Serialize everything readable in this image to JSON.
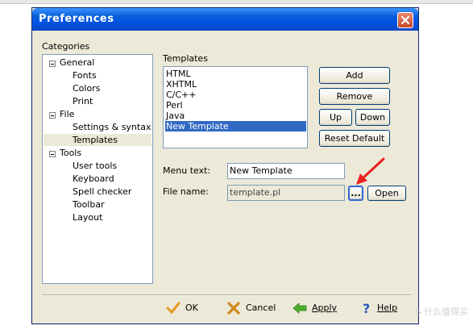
{
  "window": {
    "title": "Preferences"
  },
  "categories": {
    "label": "Categories",
    "tree": [
      {
        "label": "General",
        "expanded": true,
        "children": [
          "Fonts",
          "Colors",
          "Print"
        ]
      },
      {
        "label": "File",
        "expanded": true,
        "children": [
          "Settings & syntax",
          "Templates"
        ]
      },
      {
        "label": "Tools",
        "expanded": true,
        "children": [
          "User tools",
          "Keyboard",
          "Spell checker",
          "Toolbar",
          "Layout"
        ]
      }
    ],
    "selected": "Templates"
  },
  "templates": {
    "label": "Templates",
    "items": [
      "HTML",
      "XHTML",
      "C/C++",
      "Perl",
      "Java",
      "New Template"
    ],
    "selected": "New Template"
  },
  "buttons": {
    "add": "Add",
    "remove": "Remove",
    "up": "Up",
    "down": "Down",
    "reset_default": "Reset Default",
    "browse": "...",
    "open": "Open"
  },
  "fields": {
    "menu_text_label": "Menu text:",
    "menu_text_value": "New Template",
    "file_name_label": "File name:",
    "file_name_value": "template.pl"
  },
  "footer": {
    "ok": "OK",
    "cancel": "Cancel",
    "apply": "Apply",
    "help": "Help"
  },
  "watermark": {
    "text": "S 什么值得买"
  },
  "colors": {
    "title_bar": "#0054e3",
    "dialog_bg": "#ece9d8",
    "selection": "#316ac5",
    "annotation_arrow": "#e8211d"
  }
}
